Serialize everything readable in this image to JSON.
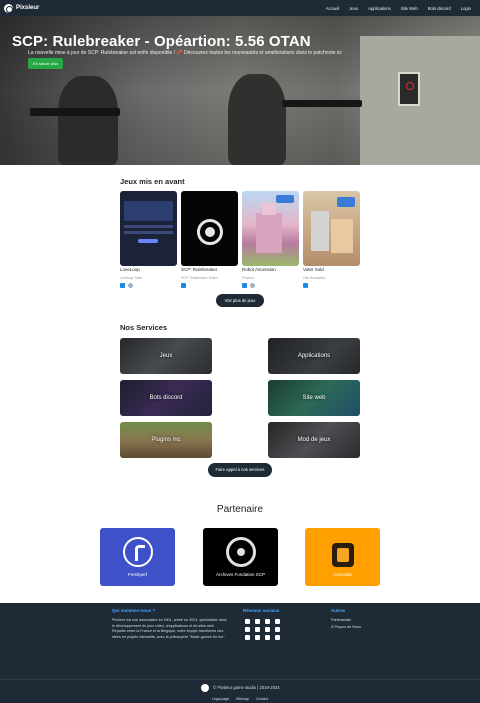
{
  "nav": {
    "brand": "Pixsleur",
    "items": [
      "Accueil",
      "Jeux",
      "Applications",
      "Site Web",
      "Bots discord",
      "Login"
    ]
  },
  "hero": {
    "title": "SCP: Rulebreaker - Opéartion: 5.56 OTAN",
    "subtitle": "La nouvelle mise à jour de SCP: Rulebreaker est enfin disponible ! 📌 Découvrez toutes les nouveautés et améliorations dans le patchnote ici",
    "button": "En savoir plus"
  },
  "featured": {
    "title": "Jeux mis en avant",
    "games": [
      {
        "name": "LoveLoop",
        "dev": "Loveloop Team",
        "platforms": [
          "windows",
          "mac"
        ]
      },
      {
        "name": "SCP: Rulebreaker",
        "dev": "SCP: Rulebreaker Studio",
        "platforms": [
          "windows"
        ]
      },
      {
        "name": "Robot Ascension",
        "dev": "Pixsleur",
        "platforms": [
          "windows",
          "mac"
        ]
      },
      {
        "name": "Voter Sold",
        "dev": "Oak Simulation",
        "platforms": [
          "windows"
        ]
      }
    ],
    "more_button": "Voir plus de jeux"
  },
  "services": {
    "title": "Nos Services",
    "items": [
      "Jeux",
      "Applications",
      "Bots discord",
      "Site web",
      "Plugins mc",
      "Mod de jeux"
    ],
    "button": "Faire appel à nos services"
  },
  "partners": {
    "title": "Partenaire",
    "items": [
      "Freshperf",
      "Archives Fondation SCP",
      "Cococlub"
    ]
  },
  "footer": {
    "about_title": "Qui sommes-nous ?",
    "about_text": "Pixsleur est une association loi 1901, créée en 2024, spécialisée dans le développement de jeux vidéo, d'applications et de sites web. Répartie entre la France et la Belgique, notre équipe transforme des idées en projets interactifs, avec la philosophie \"Make games for fun\"",
    "social_title": "Réseaux sociaux",
    "other_title": "Autres",
    "other_links": [
      "Partenariats",
      "À Propos de Nous"
    ],
    "copyright": "© Pixsleur game studio | 2019-2024",
    "bottom_links": [
      "Legal page",
      "Sitemap",
      "Contact"
    ]
  },
  "colors": {
    "nav": "#1e2a36",
    "accent": "#28a745",
    "link": "#4aa3ff",
    "partner1": "#3f51c9",
    "partner2": "#000000",
    "partner3": "#ffa000"
  }
}
